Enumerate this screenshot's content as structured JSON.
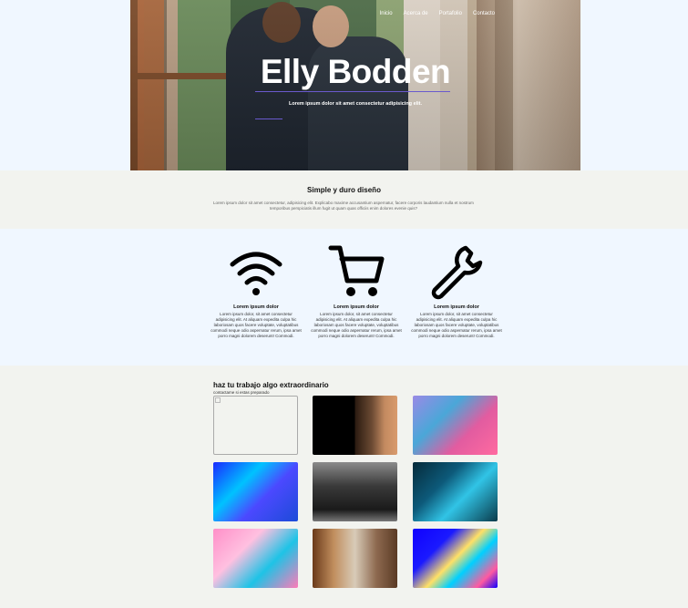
{
  "hero": {
    "title": "Elly Bodden",
    "subtitle": "Lorem ipsum dolor sit amet consectetur adipisicing elit.",
    "nav": [
      {
        "label": "Inicio"
      },
      {
        "label": "Acerca de"
      },
      {
        "label": "Portafolio"
      },
      {
        "label": "Contacto"
      }
    ]
  },
  "intro": {
    "title": "Simple y duro diseño",
    "text": "Lorem ipsum dolor sit amet consectetur, adipisicing elit. Explicabo maxime accusantium aspernatur, facere corporis laudantium nulla et nostrum temporibus perspiciatis illum fugit ut quam quas officiis enim dolores evenie quis?"
  },
  "features": [
    {
      "icon": "wifi-icon",
      "title": "Lorem ipsum dolor",
      "text": "Lorem ipsum dolor, sit amet consectetur adipisicing elit. At aliquam expedita culpa hic laboriosam quos facere voluptate, voluptatibus commodi neque odio aspernatur rerum, ipsa amet porro magni dolorem deserunt! Commodi."
    },
    {
      "icon": "shopping-cart-icon",
      "title": "Lorem ipsum dolor",
      "text": "Lorem ipsum dolor, sit amet consectetur adipisicing elit. At aliquam expedita culpa hic laboriosam quos facere voluptate, voluptatibus commodi neque odio aspernatur rerum, ipsa amet porro magni dolorem deserunt! Commodi."
    },
    {
      "icon": "wrench-icon",
      "title": "Lorem ipsum dolor",
      "text": "Lorem ipsum dolor, sit amet consectetur adipisicing elit. At aliquam expedita culpa hic laboriosam quos facere voluptate, voluptatibus commodi neque odio aspernatur rerum, ipsa amet porro magni dolorem deserunt! Commodi."
    }
  ],
  "portfolio": {
    "title": "haz tu trabajo algo extraordinario",
    "subtitle": "contactame si estas preparado"
  },
  "colors": {
    "accent": "#6a5acd",
    "section_alt": "#f2f3ef",
    "page_bg": "#f0f7ff"
  }
}
